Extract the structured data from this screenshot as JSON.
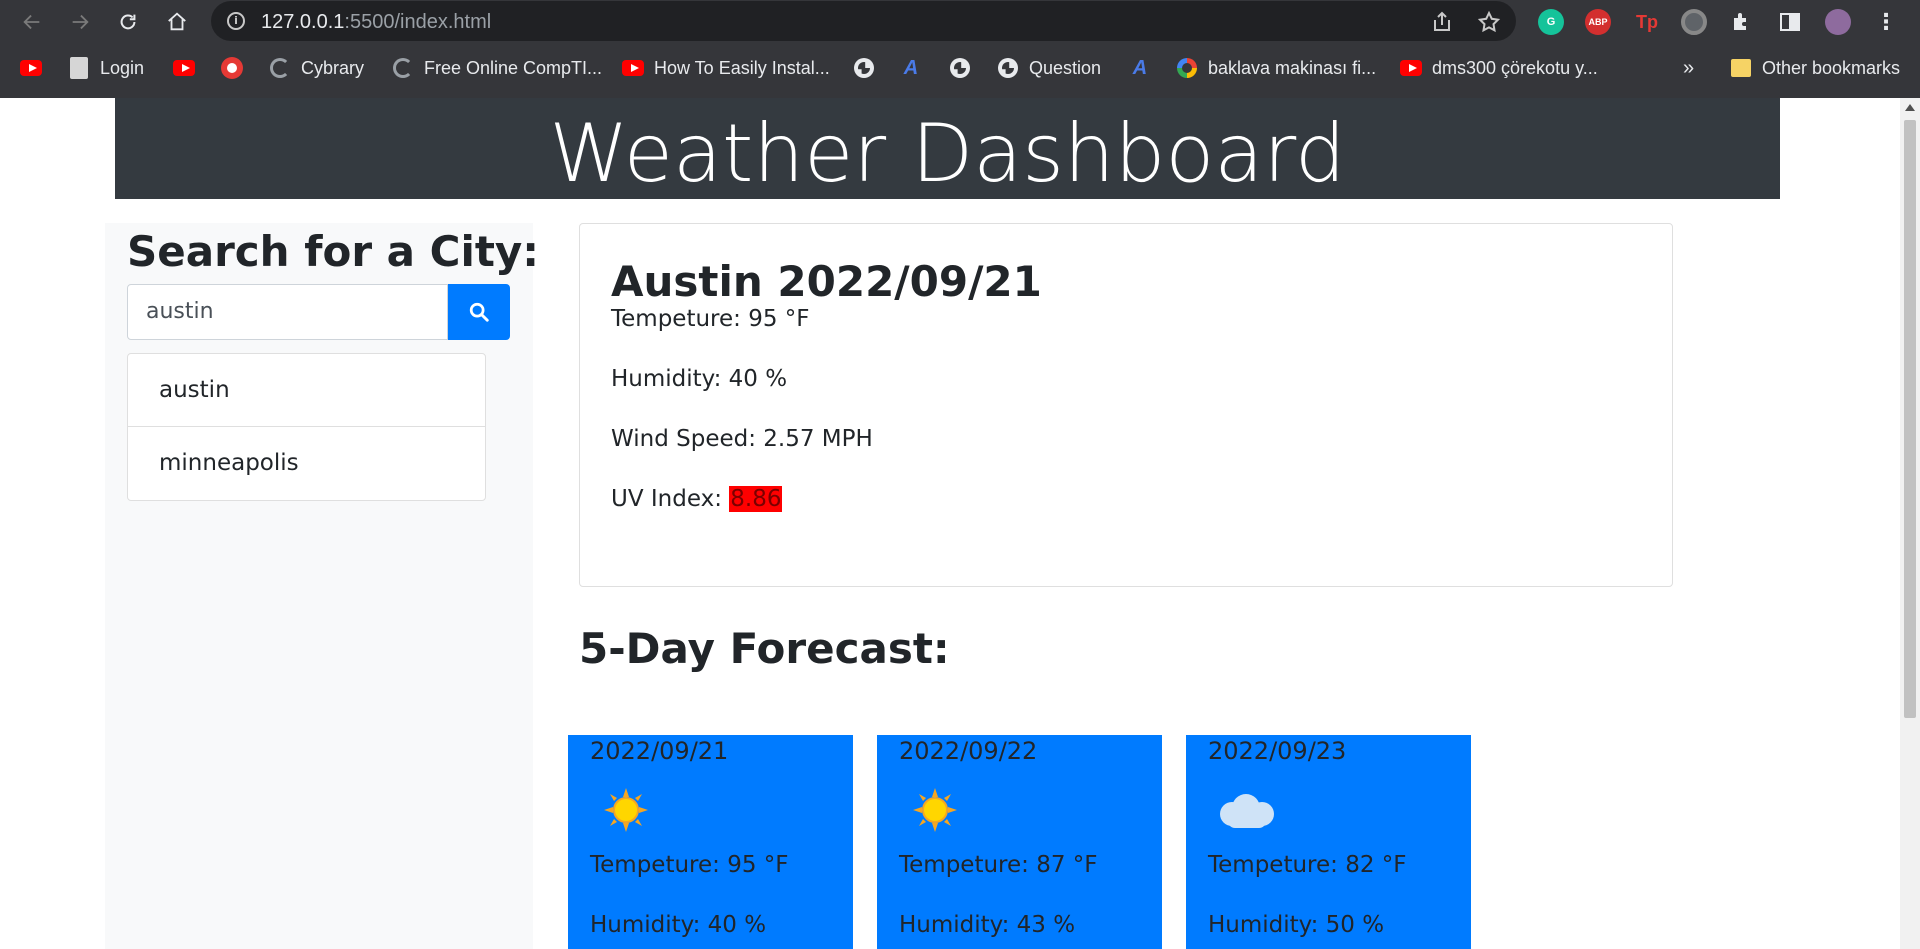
{
  "browser": {
    "url_host": "127.0.0.1",
    "url_path": ":5500/index.html",
    "bookmarks": [
      {
        "label": "",
        "icon": "youtube-icon"
      },
      {
        "label": "Login",
        "icon": "document-icon"
      },
      {
        "label": "",
        "icon": "youtube-icon"
      },
      {
        "label": "",
        "icon": "red-circle-icon"
      },
      {
        "label": "Cybrary",
        "icon": "arc-icon"
      },
      {
        "label": "Free Online CompTI...",
        "icon": "arc-icon"
      },
      {
        "label": "How To Easily Instal...",
        "icon": "youtube-icon"
      },
      {
        "label": "",
        "icon": "globe-icon"
      },
      {
        "label": "",
        "icon": "a-logo-icon"
      },
      {
        "label": "",
        "icon": "globe-icon"
      },
      {
        "label": "Question",
        "icon": "globe-icon"
      },
      {
        "label": "",
        "icon": "a-logo-icon"
      },
      {
        "label": "baklava makinası fi...",
        "icon": "google-icon"
      },
      {
        "label": "dms300 çörekotu y...",
        "icon": "youtube-icon"
      }
    ],
    "overflow_label": "»",
    "other_bookmarks": "Other bookmarks"
  },
  "header": {
    "title": "Weather Dashboard"
  },
  "sidebar": {
    "heading": "Search for a City:",
    "search_value": "austin",
    "history": [
      "austin",
      "minneapolis"
    ]
  },
  "current": {
    "title": "Austin 2022/09/21",
    "temp": "Tempeture: 95 °F",
    "humidity": "Humidity: 40 %",
    "wind": "Wind Speed: 2.57 MPH",
    "uv_label": "UV Index: ",
    "uv_value": "8.86"
  },
  "forecast": {
    "heading": "5-Day Forecast:",
    "days": [
      {
        "date": "2022/09/21",
        "icon": "sun-icon",
        "temp": "Tempeture: 95 °F",
        "humidity": "Humidity: 40 %"
      },
      {
        "date": "2022/09/22",
        "icon": "sun-icon",
        "temp": "Tempeture: 87 °F",
        "humidity": "Humidity: 43 %"
      },
      {
        "date": "2022/09/23",
        "icon": "cloud-icon",
        "temp": "Tempeture: 82 °F",
        "humidity": "Humidity: 50 %"
      }
    ]
  },
  "colors": {
    "header_bg": "#343a40",
    "primary": "#007bff",
    "uv_high": "#ff0000",
    "sidebar_bg": "#f8f9fa"
  }
}
